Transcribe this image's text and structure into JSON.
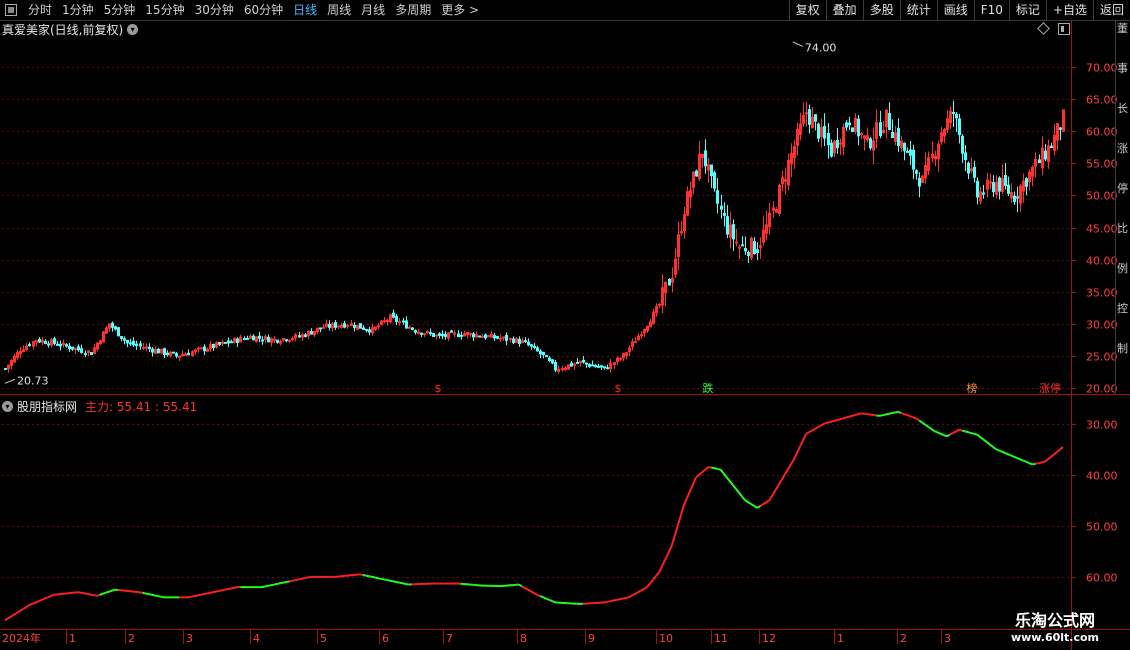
{
  "toolbar": {
    "periods": [
      "分时",
      "1分钟",
      "5分钟",
      "15分钟",
      "30分钟",
      "60分钟",
      "日线",
      "周线",
      "月线",
      "多周期",
      "更多 >"
    ],
    "active_period": "日线",
    "right_buttons": [
      "复权",
      "叠加",
      "多股",
      "统计",
      "画线",
      "F10",
      "标记",
      "+自选",
      "返回"
    ]
  },
  "main_panel": {
    "title": "真爱美家(日线,前复权)",
    "price_labels": [
      "70.00",
      "65.00",
      "60.00",
      "55.00",
      "50.00",
      "45.00",
      "40.00",
      "35.00",
      "30.00",
      "25.00",
      "20.00"
    ],
    "high_label": "74.00",
    "low_label": "20.73",
    "markers": [
      {
        "text": "$",
        "color": "#ff3030"
      },
      {
        "text": "$",
        "color": "#ff3030"
      },
      {
        "text": "跌",
        "color": "#30ff30"
      },
      {
        "text": "榜",
        "color": "#ff9020"
      },
      {
        "text": "涨停",
        "color": "#ff3030"
      }
    ]
  },
  "indicator_panel": {
    "title": "股朋指标网",
    "value_text": "主力: 55.41 : 55.41",
    "y_labels": [
      "60.00",
      "50.00",
      "40.00",
      "30.00"
    ]
  },
  "time_axis": {
    "labels": [
      "2024年",
      "1",
      "2",
      "3",
      "4",
      "5",
      "6",
      "7",
      "8",
      "9",
      "10",
      "11",
      "12",
      "1",
      "2",
      "3"
    ]
  },
  "watermark": {
    "line1": "乐淘公式网",
    "line2": "www.60lt.com"
  },
  "right_strip_text": "董事长涨停比例控制",
  "colors": {
    "up": "#ff3030",
    "down": "#54ffff",
    "line_up": "#ff2020",
    "line_down": "#20ff20",
    "grid": "#5a1010",
    "axis": "#a01010"
  },
  "chart_data": [
    {
      "type": "candlestick",
      "title": "真爱美家(日线,前复权)",
      "y_range": [
        20,
        75
      ],
      "y_ticks": [
        20,
        25,
        30,
        35,
        40,
        45,
        50,
        55,
        60,
        65,
        70
      ],
      "max_label": 74.0,
      "min_label": 20.73,
      "close_path": [
        [
          0,
          23
        ],
        [
          5,
          26
        ],
        [
          10,
          27.5
        ],
        [
          16,
          27
        ],
        [
          20,
          26.5
        ],
        [
          28,
          25.5
        ],
        [
          34,
          30
        ],
        [
          40,
          27
        ],
        [
          48,
          26
        ],
        [
          56,
          25
        ],
        [
          64,
          26
        ],
        [
          72,
          27
        ],
        [
          80,
          28
        ],
        [
          88,
          27.5
        ],
        [
          96,
          28
        ],
        [
          104,
          29.5
        ],
        [
          112,
          30
        ],
        [
          120,
          29
        ],
        [
          126,
          31
        ],
        [
          134,
          29
        ],
        [
          142,
          28
        ],
        [
          150,
          28.5
        ],
        [
          158,
          28
        ],
        [
          166,
          27.5
        ],
        [
          170,
          27
        ],
        [
          176,
          25
        ],
        [
          180,
          23
        ],
        [
          184,
          23.5
        ],
        [
          188,
          24
        ],
        [
          196,
          23
        ],
        [
          202,
          25
        ],
        [
          210,
          30
        ],
        [
          214,
          33
        ],
        [
          218,
          38
        ],
        [
          222,
          48
        ],
        [
          228,
          57
        ],
        [
          232,
          50
        ],
        [
          236,
          45
        ],
        [
          240,
          42
        ],
        [
          246,
          42
        ],
        [
          250,
          46
        ],
        [
          256,
          55
        ],
        [
          262,
          63
        ],
        [
          266,
          60
        ],
        [
          270,
          57
        ],
        [
          276,
          62
        ],
        [
          282,
          58
        ],
        [
          288,
          62
        ],
        [
          294,
          57
        ],
        [
          300,
          52
        ],
        [
          306,
          60
        ],
        [
          310,
          63
        ],
        [
          314,
          56
        ],
        [
          318,
          50
        ],
        [
          324,
          52
        ],
        [
          330,
          50
        ],
        [
          336,
          54
        ],
        [
          342,
          58
        ],
        [
          346,
          62
        ]
      ]
    },
    {
      "type": "line",
      "title": "股朋指标网",
      "series_name": "主力",
      "y_range": [
        20,
        65
      ],
      "y_ticks": [
        30,
        40,
        50,
        60
      ],
      "last_value": 55.41,
      "values": [
        [
          0,
          21.5
        ],
        [
          8,
          24.5
        ],
        [
          16,
          26.5
        ],
        [
          24,
          27
        ],
        [
          30,
          26.3
        ],
        [
          36,
          27.5
        ],
        [
          44,
          27
        ],
        [
          52,
          26
        ],
        [
          60,
          26
        ],
        [
          68,
          27
        ],
        [
          76,
          28
        ],
        [
          84,
          28
        ],
        [
          92,
          29
        ],
        [
          100,
          30
        ],
        [
          108,
          30
        ],
        [
          116,
          30.5
        ],
        [
          124,
          29.5
        ],
        [
          132,
          28.5
        ],
        [
          140,
          28.7
        ],
        [
          148,
          28.7
        ],
        [
          156,
          28.3
        ],
        [
          162,
          28.2
        ],
        [
          168,
          28.5
        ],
        [
          174,
          26.5
        ],
        [
          180,
          25
        ],
        [
          188,
          24.7
        ],
        [
          196,
          25
        ],
        [
          204,
          26
        ],
        [
          210,
          28
        ],
        [
          214,
          31
        ],
        [
          218,
          36
        ],
        [
          222,
          44
        ],
        [
          226,
          49.5
        ],
        [
          230,
          51.5
        ],
        [
          234,
          51
        ],
        [
          238,
          48
        ],
        [
          242,
          45
        ],
        [
          246,
          43.5
        ],
        [
          250,
          45
        ],
        [
          254,
          49
        ],
        [
          258,
          53
        ],
        [
          262,
          58
        ],
        [
          268,
          60
        ],
        [
          274,
          61
        ],
        [
          280,
          62
        ],
        [
          286,
          61.5
        ],
        [
          292,
          62.3
        ],
        [
          298,
          61
        ],
        [
          304,
          58.5
        ],
        [
          308,
          57.5
        ],
        [
          312,
          58.8
        ],
        [
          318,
          57.8
        ],
        [
          324,
          55
        ],
        [
          330,
          53.5
        ],
        [
          336,
          52
        ],
        [
          340,
          52.5
        ],
        [
          346,
          55.4
        ]
      ],
      "segment_trend": [
        {
          "from": 0,
          "to": 30,
          "dir": "up"
        },
        {
          "from": 30,
          "to": 36,
          "dir": "down"
        },
        {
          "from": 36,
          "to": 44,
          "dir": "up"
        },
        {
          "from": 44,
          "to": 56,
          "dir": "down"
        },
        {
          "from": 56,
          "to": 76,
          "dir": "up"
        },
        {
          "from": 76,
          "to": 92,
          "dir": "down"
        },
        {
          "from": 92,
          "to": 116,
          "dir": "up"
        },
        {
          "from": 116,
          "to": 132,
          "dir": "down"
        },
        {
          "from": 132,
          "to": 148,
          "dir": "up"
        },
        {
          "from": 148,
          "to": 168,
          "dir": "down"
        },
        {
          "from": 168,
          "to": 174,
          "dir": "up"
        },
        {
          "from": 174,
          "to": 188,
          "dir": "down"
        },
        {
          "from": 188,
          "to": 230,
          "dir": "up"
        },
        {
          "from": 230,
          "to": 246,
          "dir": "down"
        },
        {
          "from": 246,
          "to": 284,
          "dir": "up"
        },
        {
          "from": 284,
          "to": 292,
          "dir": "down"
        },
        {
          "from": 292,
          "to": 298,
          "dir": "up"
        },
        {
          "from": 298,
          "to": 308,
          "dir": "down"
        },
        {
          "from": 308,
          "to": 312,
          "dir": "up"
        },
        {
          "from": 312,
          "to": 336,
          "dir": "down"
        },
        {
          "from": 336,
          "to": 346,
          "dir": "up"
        }
      ]
    }
  ]
}
